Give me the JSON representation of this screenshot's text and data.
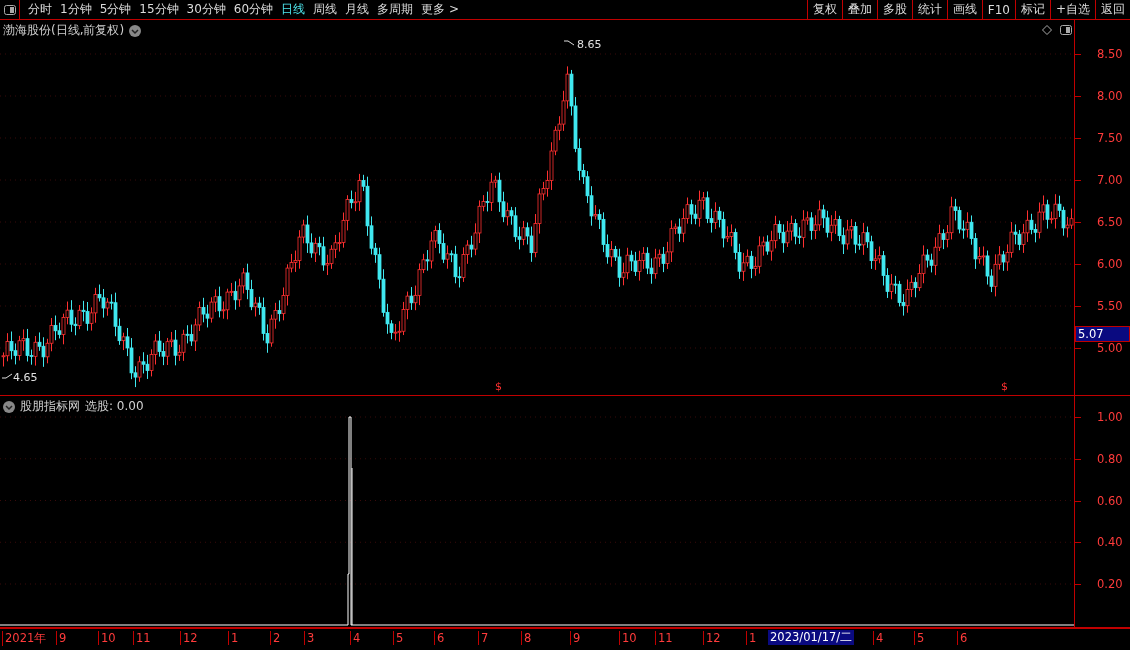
{
  "toolbar": {
    "periods": [
      {
        "label": "分时",
        "selected": false
      },
      {
        "label": "1分钟",
        "selected": false
      },
      {
        "label": "5分钟",
        "selected": false
      },
      {
        "label": "15分钟",
        "selected": false
      },
      {
        "label": "30分钟",
        "selected": false
      },
      {
        "label": "60分钟",
        "selected": false
      },
      {
        "label": "日线",
        "selected": true
      },
      {
        "label": "周线",
        "selected": false
      },
      {
        "label": "月线",
        "selected": false
      },
      {
        "label": "多周期",
        "selected": false
      },
      {
        "label": "更多 >",
        "selected": false
      }
    ],
    "actions": [
      "复权",
      "叠加",
      "多股",
      "统计",
      "画线",
      "F10",
      "标记",
      "+自选",
      "返回"
    ]
  },
  "main_panel": {
    "title": "渤海股份(日线,前复权)",
    "high_label": "8.65",
    "low_label": "4.65",
    "price_axis": [
      "8.50",
      "8.00",
      "7.50",
      "7.00",
      "6.50",
      "6.00",
      "5.50",
      "5.00"
    ],
    "cursor_price": "5.07",
    "signals": [
      "$",
      "$"
    ]
  },
  "indicator_panel": {
    "name": "股朋指标网",
    "reading": "选股: 0.00",
    "axis": [
      "1.00",
      "0.80",
      "0.60",
      "0.40",
      "0.20"
    ]
  },
  "date_axis": {
    "labels": [
      "2021年",
      "9",
      "10",
      "11",
      "12",
      "1",
      "2",
      "3",
      "4",
      "5",
      "6",
      "7",
      "8",
      "9",
      "10",
      "11",
      "12",
      "1",
      "4",
      "5",
      "6"
    ],
    "cursor": "2023/01/17/二"
  }
}
